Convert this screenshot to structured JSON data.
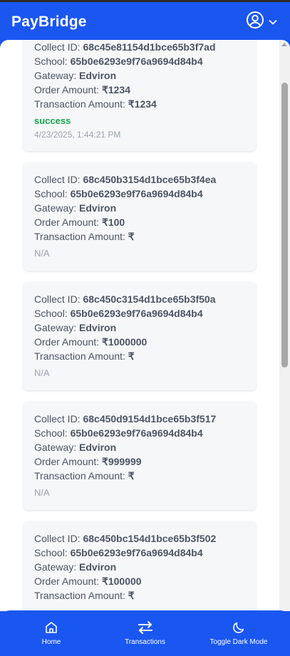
{
  "header": {
    "title": "PayBridge"
  },
  "transactions": [
    {
      "collect_label": "Collect ID:",
      "collect_id": "68c45e81154d1bce65b3f7ad",
      "school_label": "School:",
      "school": "65b0e6293e9f76a9694d84b4",
      "gateway_label": "Gateway:",
      "gateway": "Edviron",
      "order_label": "Order Amount:",
      "order_amount": "₹1234",
      "txn_label": "Transaction Amount:",
      "txn_amount": "₹1234",
      "status": "success",
      "time": "4/23/2025, 1:44:21 PM"
    },
    {
      "collect_label": "Collect ID:",
      "collect_id": "68c450b3154d1bce65b3f4ea",
      "school_label": "School:",
      "school": "65b0e6293e9f76a9694d84b4",
      "gateway_label": "Gateway:",
      "gateway": "Edviron",
      "order_label": "Order Amount:",
      "order_amount": "₹100",
      "txn_label": "Transaction Amount:",
      "txn_amount": "₹",
      "status": "N/A",
      "time": ""
    },
    {
      "collect_label": "Collect ID:",
      "collect_id": "68c450c3154d1bce65b3f50a",
      "school_label": "School:",
      "school": "65b0e6293e9f76a9694d84b4",
      "gateway_label": "Gateway:",
      "gateway": "Edviron",
      "order_label": "Order Amount:",
      "order_amount": "₹1000000",
      "txn_label": "Transaction Amount:",
      "txn_amount": "₹",
      "status": "N/A",
      "time": ""
    },
    {
      "collect_label": "Collect ID:",
      "collect_id": "68c450d9154d1bce65b3f517",
      "school_label": "School:",
      "school": "65b0e6293e9f76a9694d84b4",
      "gateway_label": "Gateway:",
      "gateway": "Edviron",
      "order_label": "Order Amount:",
      "order_amount": "₹999999",
      "txn_label": "Transaction Amount:",
      "txn_amount": "₹",
      "status": "N/A",
      "time": ""
    },
    {
      "collect_label": "Collect ID:",
      "collect_id": "68c450bc154d1bce65b3f502",
      "school_label": "School:",
      "school": "65b0e6293e9f76a9694d84b4",
      "gateway_label": "Gateway:",
      "gateway": "Edviron",
      "order_label": "Order Amount:",
      "order_amount": "₹100000",
      "txn_label": "Transaction Amount:",
      "txn_amount": "₹",
      "status": "",
      "time": ""
    }
  ],
  "nav": {
    "home": "Home",
    "transactions": "Transactions",
    "dark_mode": "Toggle Dark Mode"
  },
  "icons": {
    "account": "user-circle-icon",
    "dropdown": "chevron-down-icon",
    "home": "home-icon",
    "transactions": "swap-arrows-icon",
    "dark_mode": "moon-icon"
  },
  "colors": {
    "brand": "#1a56f0",
    "success": "#16a34a"
  }
}
